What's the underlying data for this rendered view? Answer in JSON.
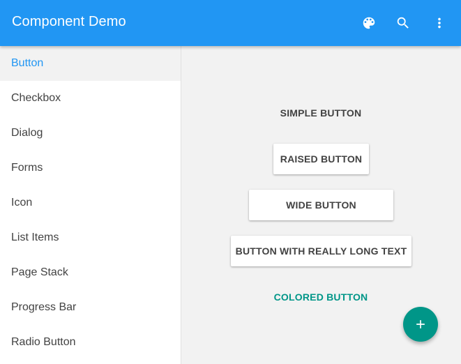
{
  "toolbar": {
    "title": "Component Demo",
    "icons": [
      "palette-icon",
      "search-icon",
      "more-vert-icon"
    ]
  },
  "sidebar": {
    "items": [
      {
        "label": "Button",
        "active": true
      },
      {
        "label": "Checkbox"
      },
      {
        "label": "Dialog"
      },
      {
        "label": "Forms"
      },
      {
        "label": "Icon"
      },
      {
        "label": "List Items"
      },
      {
        "label": "Page Stack"
      },
      {
        "label": "Progress Bar"
      },
      {
        "label": "Radio Button"
      }
    ]
  },
  "main": {
    "buttons": {
      "simple": "SIMPLE BUTTON",
      "raised": "RAISED BUTTON",
      "wide": "WIDE BUTTON",
      "long": "BUTTON WITH REALLY LONG TEXT",
      "colored": "COLORED BUTTON"
    },
    "fab_icon": "add-icon"
  },
  "colors": {
    "primary": "#2196f3",
    "accent": "#009688",
    "background": "#f2f2f2",
    "text": "#424242"
  }
}
